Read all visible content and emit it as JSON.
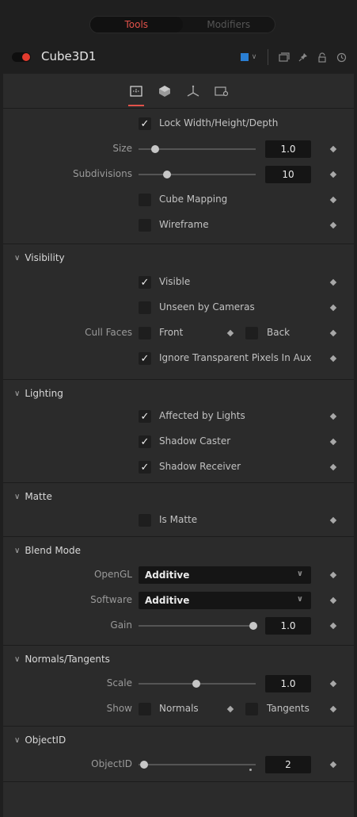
{
  "tabs_top": {
    "tools": "Tools",
    "modifiers": "Modifiers"
  },
  "node": {
    "name": "Cube3D1",
    "color": "#2a7fd4"
  },
  "controls": {
    "lock": "Lock Width/Height/Depth",
    "size_label": "Size",
    "size_value": "1.0",
    "size_fraction": 0.14,
    "subdiv_label": "Subdivisions",
    "subdiv_value": "10",
    "subdiv_fraction": 0.24,
    "cube_mapping": "Cube Mapping",
    "wireframe": "Wireframe"
  },
  "visibility": {
    "title": "Visibility",
    "visible": "Visible",
    "unseen": "Unseen by Cameras",
    "cull_label": "Cull Faces",
    "front": "Front",
    "back": "Back",
    "ignore": "Ignore Transparent Pixels In Aux"
  },
  "lighting": {
    "title": "Lighting",
    "affected": "Affected by Lights",
    "caster": "Shadow Caster",
    "receiver": "Shadow Receiver"
  },
  "matte": {
    "title": "Matte",
    "is_matte": "Is Matte"
  },
  "blend": {
    "title": "Blend Mode",
    "opengl_label": "OpenGL",
    "opengl_value": "Additive",
    "software_label": "Software",
    "software_value": "Additive",
    "gain_label": "Gain",
    "gain_value": "1.0",
    "gain_fraction": 0.98
  },
  "normals": {
    "title": "Normals/Tangents",
    "scale_label": "Scale",
    "scale_value": "1.0",
    "scale_fraction": 0.49,
    "show_label": "Show",
    "normals": "Normals",
    "tangents": "Tangents"
  },
  "objectid": {
    "title": "ObjectID",
    "label": "ObjectID",
    "value": "2",
    "fraction": 0.05
  },
  "icons": [
    "controls-tab-icon",
    "material-tab-icon",
    "transform-tab-icon",
    "settings-tab-icon"
  ]
}
